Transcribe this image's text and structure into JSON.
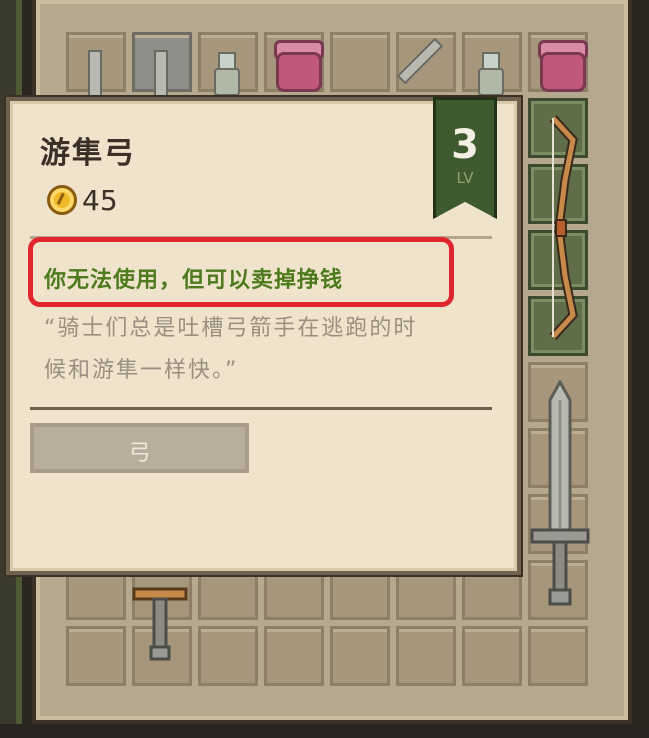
{
  "item": {
    "name": "游隼弓",
    "price": "45",
    "level": "3",
    "level_suffix": "LV",
    "notice": "你无法使用，但可以卖掉挣钱",
    "description_lines": [
      "“骑士们总是吐槽弓箭手在逃跑的时",
      "候和游隼一样快。”"
    ],
    "type": "弓"
  },
  "colors": {
    "notice_text": "#4d7a1c",
    "notice_border": "#e0262f",
    "level_badge": "#3f5a2e",
    "tooltip_bg": "#efe3cc"
  },
  "icons": {
    "coin": "gold-coin-icon",
    "bow": "bow-icon",
    "sword": "sword-icon",
    "potion": "potion-icon",
    "jar": "jar-icon"
  }
}
